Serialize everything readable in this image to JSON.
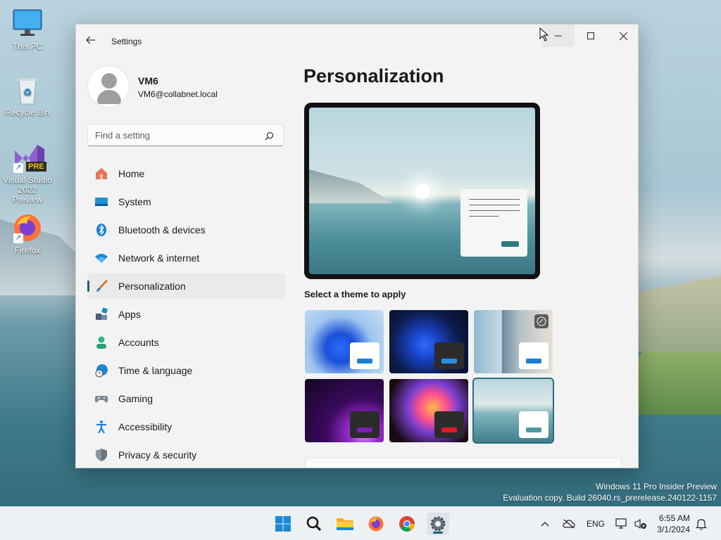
{
  "desktop": {
    "icons": [
      {
        "label": "This PC",
        "icon": "monitor-icon"
      },
      {
        "label": "Recycle Bin",
        "icon": "recycle-bin-icon"
      },
      {
        "label": "Visual Studio 2022 Preview",
        "icon": "visual-studio-icon",
        "badge": "PRE"
      },
      {
        "label": "Firefox",
        "icon": "firefox-icon"
      }
    ],
    "watermark": {
      "line1": "Windows 11 Pro Insider Preview",
      "line2": "Evaluation copy. Build 26040.rs_prerelease.240122-1157"
    }
  },
  "window": {
    "title": "Settings",
    "user": {
      "name": "VM6",
      "email": "VM6@collabnet.local"
    },
    "search": {
      "placeholder": "Find a setting"
    },
    "nav": [
      {
        "label": "Home",
        "icon": "home-icon"
      },
      {
        "label": "System",
        "icon": "system-icon"
      },
      {
        "label": "Bluetooth & devices",
        "icon": "bluetooth-icon"
      },
      {
        "label": "Network & internet",
        "icon": "wifi-icon"
      },
      {
        "label": "Personalization",
        "icon": "brush-icon",
        "active": true
      },
      {
        "label": "Apps",
        "icon": "apps-icon"
      },
      {
        "label": "Accounts",
        "icon": "accounts-icon"
      },
      {
        "label": "Time & language",
        "icon": "clock-globe-icon"
      },
      {
        "label": "Gaming",
        "icon": "gamepad-icon"
      },
      {
        "label": "Accessibility",
        "icon": "accessibility-icon"
      },
      {
        "label": "Privacy & security",
        "icon": "shield-icon"
      }
    ],
    "page_title": "Personalization",
    "theme_section_label": "Select a theme to apply",
    "themes": [
      {
        "name": "windows-light-bloom",
        "selected": false
      },
      {
        "name": "windows-dark-bloom",
        "selected": false
      },
      {
        "name": "flowers",
        "selected": false
      },
      {
        "name": "glow",
        "selected": false
      },
      {
        "name": "captured-motion",
        "selected": false
      },
      {
        "name": "lake",
        "selected": true
      }
    ],
    "colors": {
      "accent": "#1f5f7a",
      "selected_outline": "#2c6c80"
    }
  },
  "taskbar": {
    "apps": [
      "start-icon",
      "search-icon",
      "file-explorer-icon",
      "firefox-icon",
      "chrome-icon",
      "settings-icon"
    ],
    "active_app": "settings-icon",
    "tray": {
      "language": "ENG"
    },
    "clock": {
      "time": "6:55 AM",
      "date": "3/1/2024"
    }
  }
}
